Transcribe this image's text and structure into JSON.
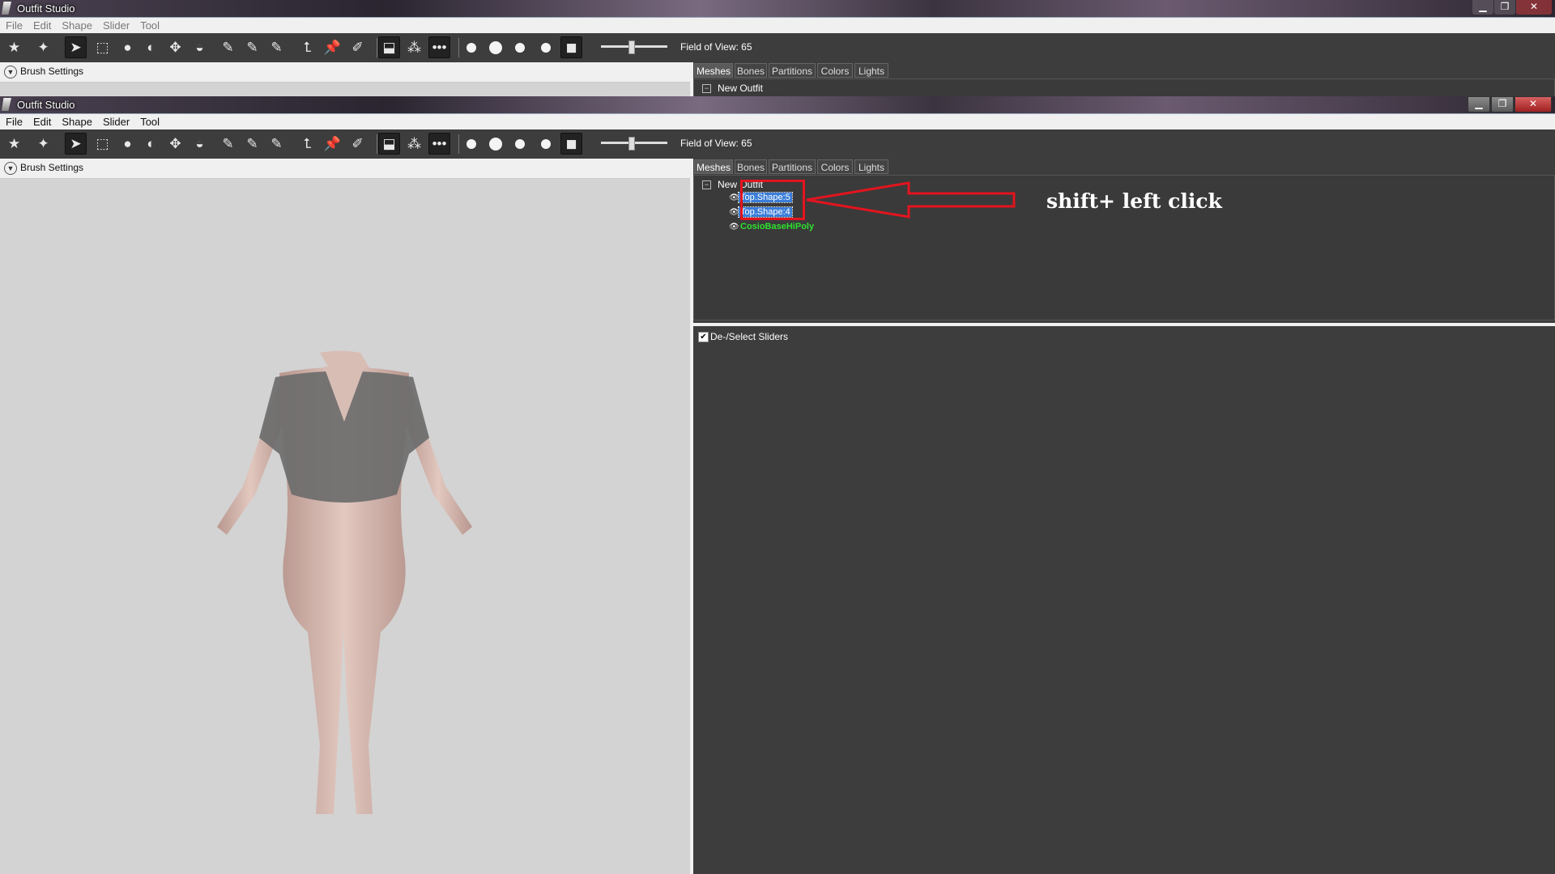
{
  "app": {
    "title": "Outfit Studio",
    "window_buttons": {
      "minimize": "▁",
      "maximize": "❐",
      "close": "✕"
    }
  },
  "menu": [
    "File",
    "Edit",
    "Shape",
    "Slider",
    "Tool"
  ],
  "toolbar": {
    "fov_label": "Field of View: 65",
    "tools": [
      "load-reference-icon",
      "load-outfit-icon",
      "select-icon",
      "transform-select-icon",
      "standard-brush-icon",
      "deflate-brush-icon",
      "move-brush-icon",
      "smooth-brush-icon",
      "mask-brush-icon",
      "color-brush-icon",
      "erase-brush-icon",
      "alpha-brush-icon",
      "collision-icon",
      "anchor-icon",
      "pencil-icon",
      "xmirror-icon",
      "connected-icon",
      "dots-icon",
      "dot-small-icon",
      "dot-medium-icon",
      "dot-large-icon",
      "dot-xl-icon",
      "cube-icon"
    ]
  },
  "left_panel": {
    "brush_settings_label": "Brush Settings"
  },
  "tabs": [
    {
      "label": "Meshes",
      "selected": true
    },
    {
      "label": "Bones",
      "selected": false
    },
    {
      "label": "Partitions",
      "selected": false
    },
    {
      "label": "Colors",
      "selected": false
    },
    {
      "label": "Lights",
      "selected": false
    }
  ],
  "mesh_tree": {
    "root": "New Outfit",
    "shapes": [
      {
        "label": "Top.Shape:5",
        "selected": true,
        "color": "#3b7ed8"
      },
      {
        "label": "Top.Shape:4",
        "selected": true,
        "color": "#3b7ed8"
      },
      {
        "label": "CosioBaseHiPoly",
        "selected": false,
        "color": "#2ee02e"
      }
    ]
  },
  "annotation": {
    "text": "shift+ left click",
    "color": "#e3141e"
  },
  "sliders": {
    "deselect_label": "De-/Select Sliders",
    "checked": true
  }
}
